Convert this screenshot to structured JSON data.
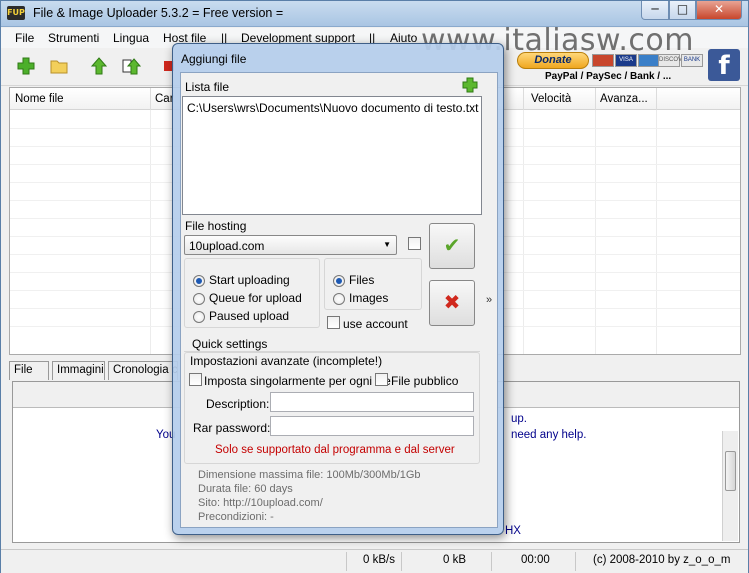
{
  "window": {
    "title": "File & Image Uploader 5.3.2  = Free version =",
    "icon_text": "FUP",
    "minimize": "─",
    "maximize": "□",
    "close": "✕"
  },
  "menu": [
    "File",
    "Strumenti",
    "Lingua",
    "Host file",
    "||",
    "Development support",
    "||",
    "Aiuto"
  ],
  "watermark": "www.italiasw.com",
  "donate": {
    "label": "Donate",
    "cards": [
      "",
      "VISA",
      "",
      "DISCOVER",
      "BANK"
    ],
    "payment_label": "PayPal / PaySec / Bank / ..."
  },
  "list": {
    "columns": [
      "Nome file",
      "Car",
      "Velocità",
      "Avanza..."
    ]
  },
  "bottom_tabs": [
    "File",
    "Immagini",
    "Cronologia ca"
  ],
  "bottom_panel": {
    "text_1": "You",
    "text_2": "up.",
    "text_3": "need any help.",
    "text_4": "HX"
  },
  "status": {
    "speed": "0 kB/s",
    "size": "0 kB",
    "time": "00:00",
    "copyright": "(c) 2008-2010 by z_o_o_m"
  },
  "dialog": {
    "title": "Aggiungi file",
    "lista_label": "Lista file",
    "file_path": "C:\\Users\\wrs\\Documents\\Nuovo documento di testo.txt",
    "hosting_label": "File hosting",
    "hosting_value": "10upload.com",
    "upload_options": [
      "Start uploading",
      "Queue for upload",
      "Paused upload"
    ],
    "upload_selected": 0,
    "type_options": [
      "Files",
      "Images"
    ],
    "type_selected": 0,
    "use_account": "use account",
    "quick_settings": "Quick settings",
    "advanced_label": "Impostazioni avanzate (incomplete!)",
    "set_individually": "Imposta singolarmente per ogni file",
    "public_file": "File pubblico",
    "description_label": "Description:",
    "rar_password_label": "Rar password:",
    "warning": "Solo se supportato dal programma e dal server",
    "info": [
      "Dimensione massima file: 100Mb/300Mb/1Gb",
      "Durata file: 60 days",
      "Sito: http://10upload.com/",
      "Precondizioni: -"
    ],
    "expand": "»",
    "ok_glyph": "✔",
    "cancel_glyph": "✖"
  },
  "colors": {
    "ok_green": "#5aa52a",
    "cancel_red": "#d0281d",
    "warning_red": "#c40000"
  }
}
